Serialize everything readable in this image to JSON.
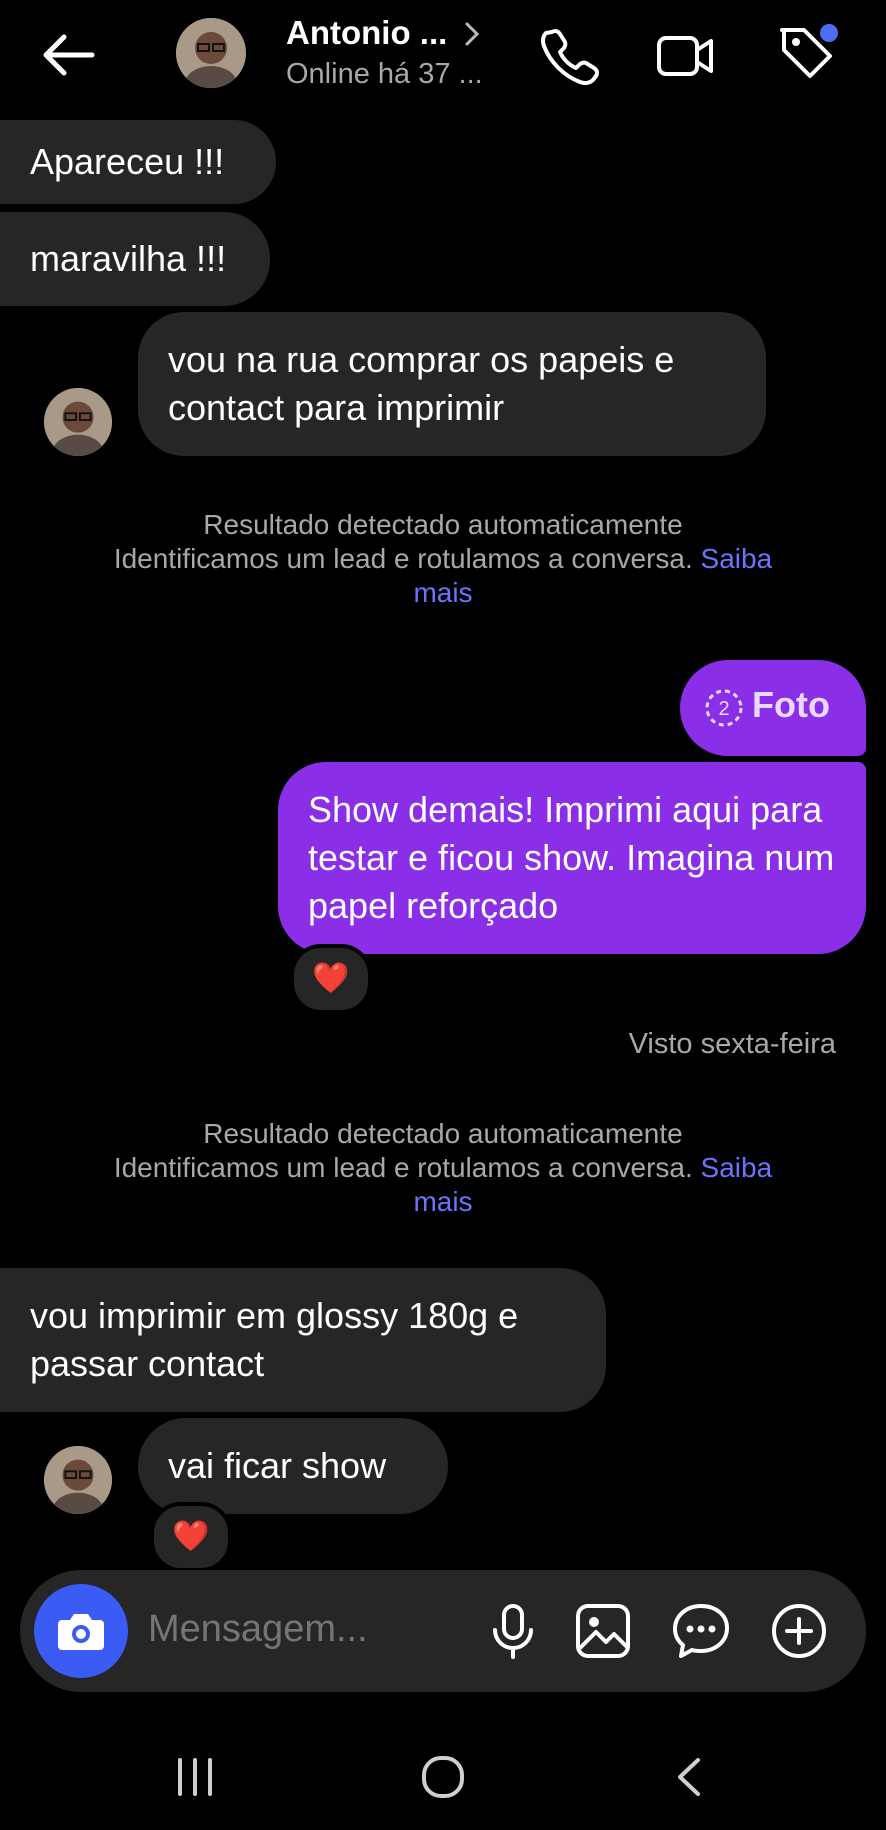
{
  "header": {
    "contact_name": "Antonio ...",
    "status": "Online há 37 ...",
    "avatar_icon": "user-avatar-photo"
  },
  "messages": [
    {
      "id": "m1",
      "direction": "incoming",
      "text": "Apareceu !!!"
    },
    {
      "id": "m2",
      "direction": "incoming",
      "text": "maravilha !!!"
    },
    {
      "id": "m3",
      "direction": "incoming",
      "text": "vou na rua comprar os papeis e\ncontact para imprimir"
    },
    {
      "id": "m4",
      "direction": "outgoing",
      "type": "photo",
      "count": "2",
      "text": "Foto"
    },
    {
      "id": "m5",
      "direction": "outgoing",
      "text": "Show demais! Imprimi aqui para testar e ficou show. Imagina num papel reforçado",
      "reaction": "❤️"
    },
    {
      "id": "m6",
      "direction": "incoming",
      "text": "vou imprimir em glossy 180g e\npassar contact"
    },
    {
      "id": "m7",
      "direction": "incoming",
      "text": "vai ficar show",
      "reaction": "❤️"
    }
  ],
  "system_notices": [
    {
      "line1": "Resultado detectado automaticamente",
      "line2": "Identificamos um lead e rotulamos a conversa.",
      "link": "Saiba",
      "link2": "mais"
    },
    {
      "line1": "Resultado detectado automaticamente",
      "line2": "Identificamos um lead e rotulamos a conversa.",
      "link": "Saiba",
      "link2": "mais"
    }
  ],
  "seen_status": "Visto sexta-feira",
  "composer": {
    "placeholder": "Mensagem..."
  },
  "colors": {
    "outgoing_bubble": "#8a2ee8",
    "incoming_bubble": "#262626",
    "link": "#6d73ff",
    "camera_button": "#3b5bf5",
    "notification_dot": "#4f6cf5"
  }
}
